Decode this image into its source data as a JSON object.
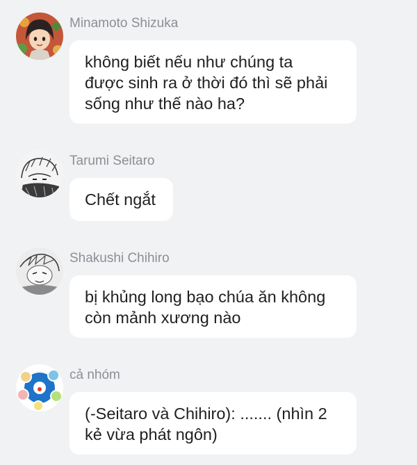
{
  "messages": [
    {
      "sender": "Minamoto Shizuka",
      "avatar_icon": "shizuka-avatar-icon",
      "lines": [
        "không biết nếu như chúng ta",
        "được sinh ra ở thời đó thì sẽ phải",
        "sống như thế nào ha?"
      ]
    },
    {
      "sender": "Tarumi Seitaro",
      "avatar_icon": "seitaro-avatar-icon",
      "lines": [
        "Chết ngắt"
      ]
    },
    {
      "sender": "Shakushi Chihiro",
      "avatar_icon": "chihiro-avatar-icon",
      "lines": [
        "bị khủng long bạo chúa ăn không",
        "còn mảnh xương nào"
      ]
    },
    {
      "sender": "cả nhóm",
      "avatar_icon": "group-avatar-icon",
      "lines": [
        "(-Seitaro và Chihiro): ....... (nhìn 2",
        "kẻ vừa phát ngôn)"
      ]
    }
  ],
  "colors": {
    "background": "#f1f2f4",
    "bubble": "#ffffff",
    "sender_text": "#8b8f95",
    "message_text": "#1e1f21"
  }
}
